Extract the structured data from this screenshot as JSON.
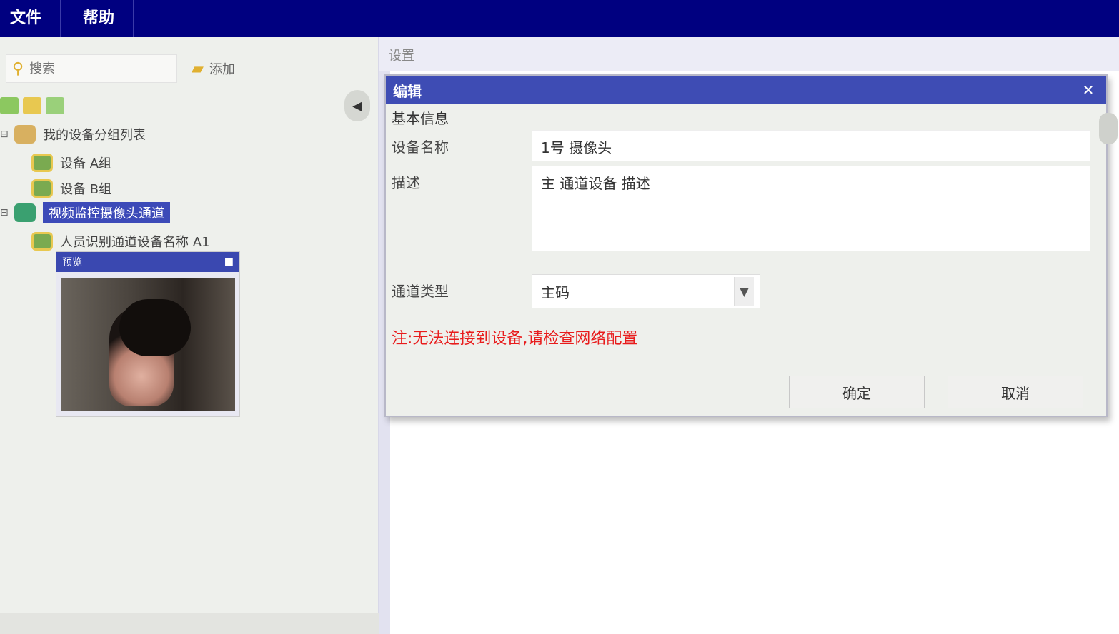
{
  "menubar": {
    "items": [
      {
        "label": "文件"
      },
      {
        "label": "帮助"
      }
    ]
  },
  "left_panel": {
    "search": {
      "placeholder": "搜索",
      "icon": "search-icon"
    },
    "toolbar_button": {
      "label": "添加",
      "icon": "folder-icon"
    },
    "tree": [
      {
        "label": "我的设备分组列表",
        "icon": "folder-icon",
        "level": 0
      },
      {
        "label": "设备 A组",
        "icon": "user-icon",
        "level": 1
      },
      {
        "label": "设备 B组",
        "icon": "user-icon",
        "level": 1
      },
      {
        "label": "视频监控摄像头通道",
        "icon": "camera-icon",
        "level": 0,
        "selected": true
      },
      {
        "label": "人员识别通道设备名称 A1",
        "icon": "user-icon",
        "level": 1
      }
    ],
    "preview": {
      "title": "预览",
      "close_icon": "close-icon"
    }
  },
  "right_panel": {
    "header": "设置"
  },
  "dialog": {
    "title": "编辑",
    "subtitle": "基本信息",
    "fields": [
      {
        "label": "设备名称",
        "value": "1号 摄像头"
      },
      {
        "label": "描述",
        "value": "主 通道设备 描述"
      }
    ],
    "select": {
      "label": "通道类型",
      "value": "主码"
    },
    "error": "注:无法连接到设备,请检查网络配置",
    "buttons": {
      "ok": "确定",
      "cancel": "取消"
    }
  }
}
